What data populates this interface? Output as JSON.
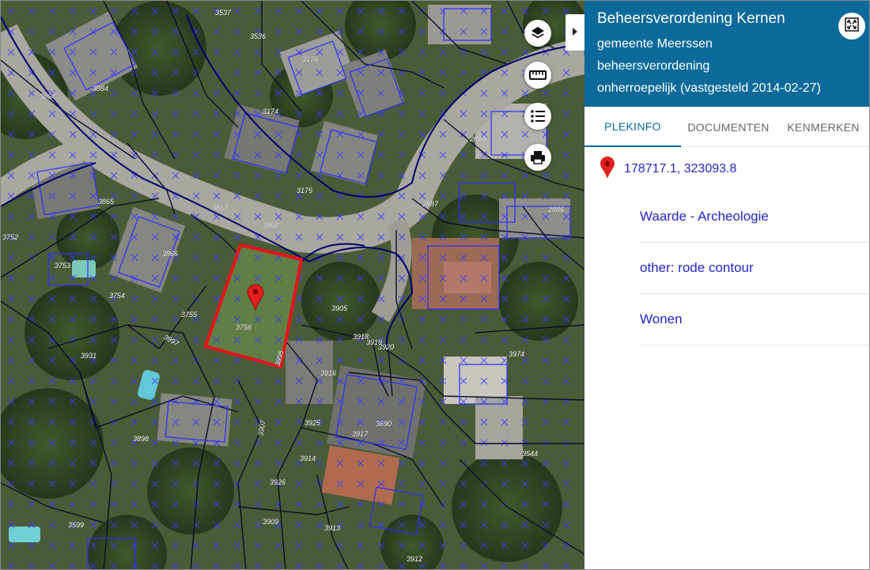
{
  "panel": {
    "title": "Beheersverordening Kernen",
    "lines": [
      "gemeente Meerssen",
      "beheersverordening",
      "onherroepelijk (vastgesteld 2014-02-27)"
    ],
    "accent_color": "#0b6a99"
  },
  "tabs": [
    {
      "label": "PLEKINFO",
      "active": true
    },
    {
      "label": "DOCUMENTEN",
      "active": false
    },
    {
      "label": "KENMERKEN",
      "active": false
    }
  ],
  "location": {
    "coordinates": "178717.1, 323093.8",
    "icon": "map-pin-icon"
  },
  "info_items": [
    {
      "label": "Waarde - Archeologie"
    },
    {
      "label": "other: rode contour"
    },
    {
      "label": "Wonen"
    }
  ],
  "map": {
    "tools": [
      {
        "name": "layers-icon"
      },
      {
        "name": "ruler-icon"
      },
      {
        "name": "legend-list-icon"
      },
      {
        "name": "print-icon"
      }
    ],
    "selection_color": "#e8141b",
    "parcel_labels": [
      "3537",
      "3536",
      "3176",
      "3864",
      "3884",
      "3174",
      "2860",
      "3175",
      "3865",
      "3867",
      "3868",
      "2887",
      "2886",
      "3752",
      "3753",
      "3866",
      "3754",
      "3755",
      "3756",
      "3905",
      "3997",
      "3931",
      "3918",
      "3919",
      "3920",
      "3974",
      "3916",
      "3895",
      "3917",
      "3690",
      "3898",
      "3925",
      "3907",
      "3914",
      "3544",
      "3926",
      "3599",
      "3909",
      "3913",
      "3912"
    ]
  }
}
